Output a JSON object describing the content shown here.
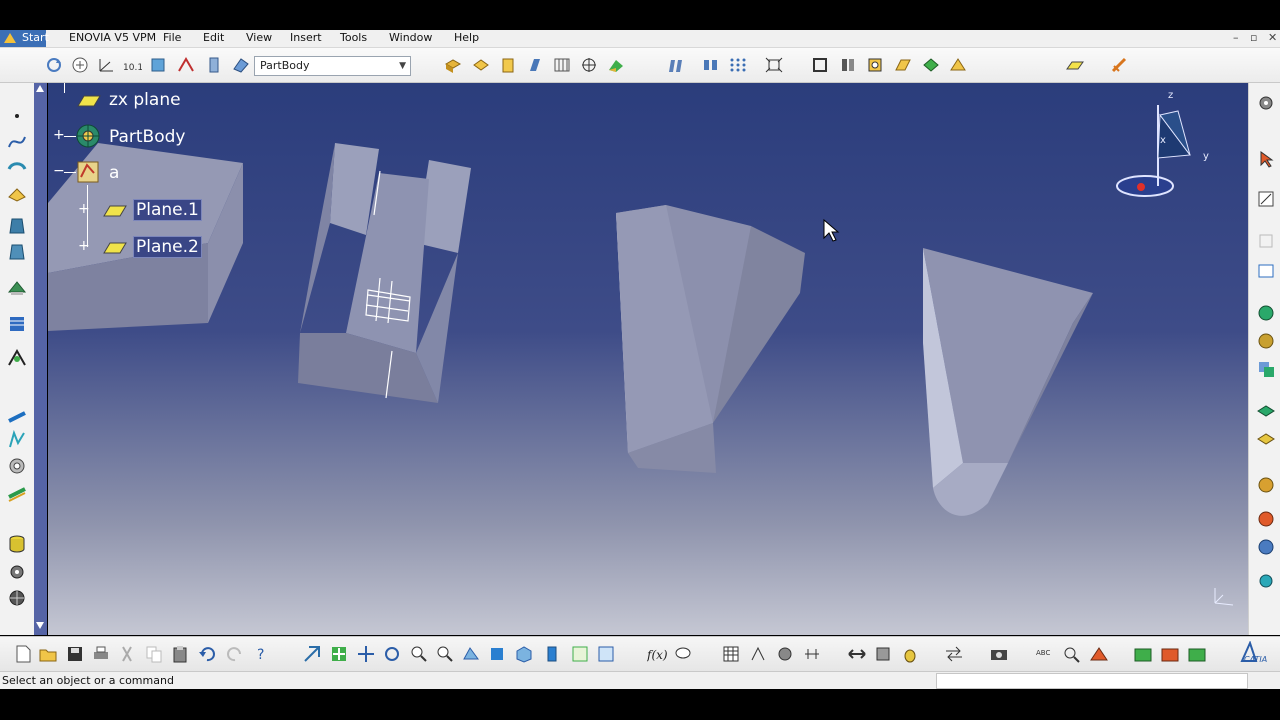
{
  "menubar": {
    "start": "Start",
    "items": [
      "ENOVIA V5 VPM",
      "File",
      "Edit",
      "View",
      "Insert",
      "Tools",
      "Window",
      "Help"
    ]
  },
  "toolbar": {
    "body_combo": "PartBody"
  },
  "tree": {
    "zx_plane": "zx plane",
    "partbody": "PartBody",
    "geoset": "a",
    "plane1": "Plane.1",
    "plane2": "Plane.2"
  },
  "compass": {
    "x": "x",
    "y": "y",
    "z": "z"
  },
  "status": {
    "message": "Select an object or a command"
  },
  "watermark": "CATIA",
  "colors": {
    "viewport_top": "#2b3d7c",
    "viewport_bottom": "#c5c7d3",
    "solid_face": "#8c90ad",
    "selection": "#3a4686"
  }
}
